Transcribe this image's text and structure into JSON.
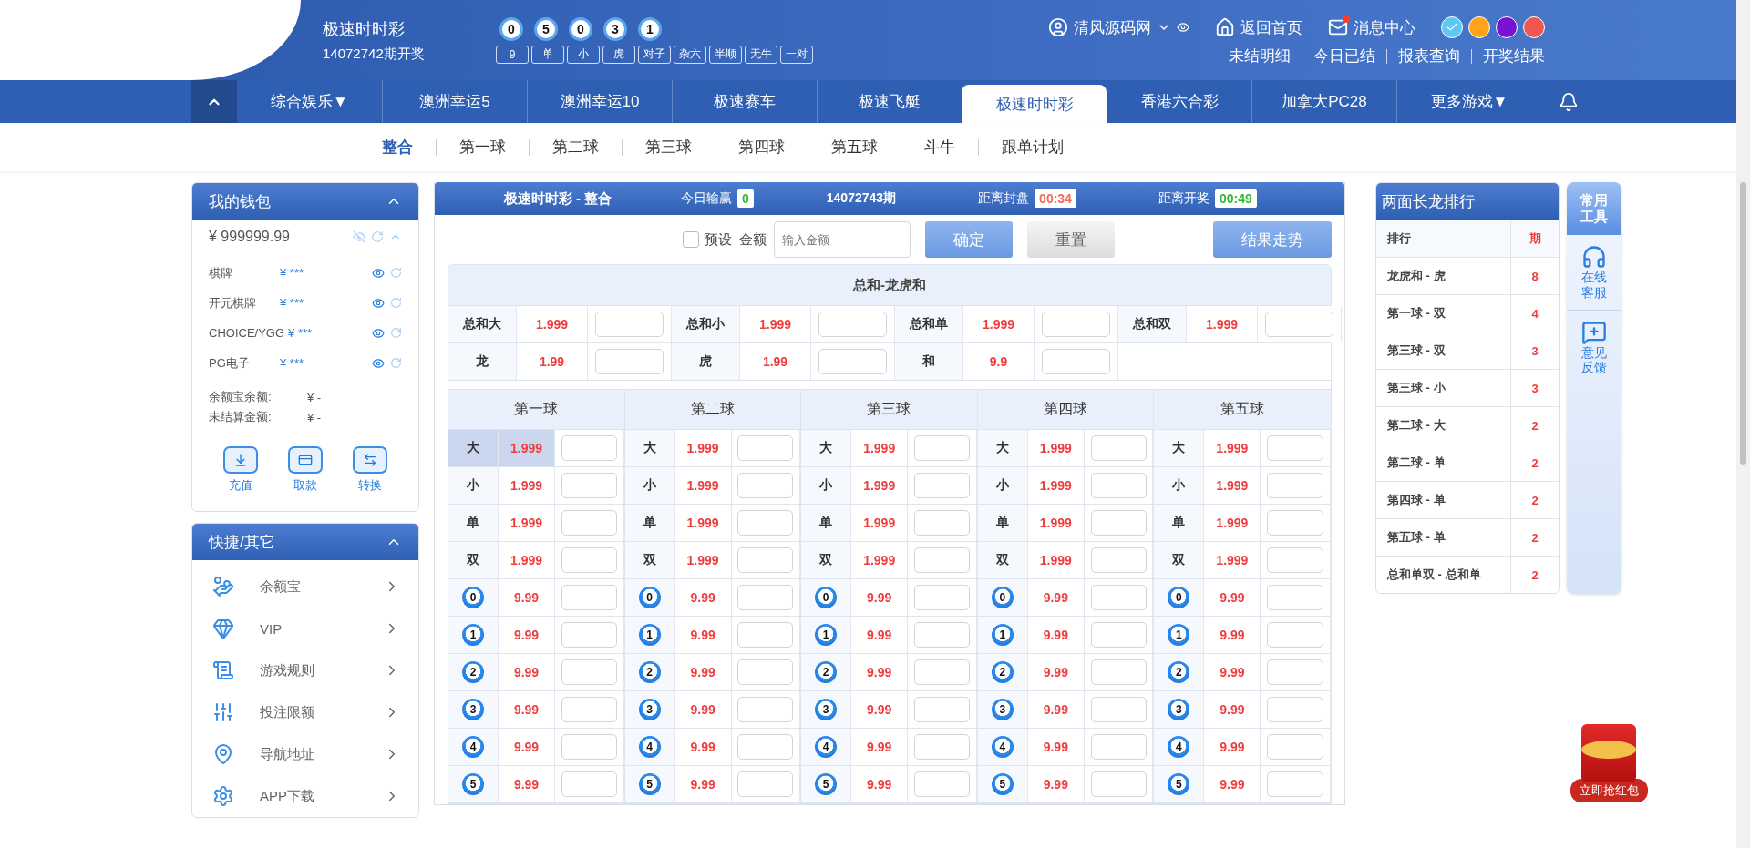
{
  "header": {
    "title": "极速时时彩",
    "issue": "14072742期开奖",
    "balls": [
      "0",
      "5",
      "0",
      "3",
      "1"
    ],
    "tags": [
      "9",
      "单",
      "小",
      "虎",
      "对子",
      "杂六",
      "半顺",
      "无牛",
      "一对"
    ],
    "user": "清风源码网",
    "links": [
      {
        "label": "返回首页",
        "kind": "home",
        "badge": false
      },
      {
        "label": "消息中心",
        "kind": "mail",
        "badge": true
      }
    ],
    "themes": [
      {
        "color": "#5ec8f5",
        "selected": true
      },
      {
        "color": "#ffa31a",
        "selected": false
      },
      {
        "color": "#7a12d6",
        "selected": false
      },
      {
        "color": "#f0584f",
        "selected": false
      }
    ],
    "sub_links": [
      "未结明细",
      "今日已结",
      "报表查询",
      "开奖结果"
    ]
  },
  "nav": [
    {
      "label": "综合娱乐▼",
      "selected": false
    },
    {
      "label": "澳洲幸运5",
      "selected": false
    },
    {
      "label": "澳洲幸运10",
      "selected": false
    },
    {
      "label": "极速赛车",
      "selected": false
    },
    {
      "label": "极速飞艇",
      "selected": false
    },
    {
      "label": "极速时时彩",
      "selected": true
    },
    {
      "label": "香港六合彩",
      "selected": false
    },
    {
      "label": "加拿大PC28",
      "selected": false
    },
    {
      "label": "更多游戏▼",
      "selected": false
    }
  ],
  "subnav": [
    {
      "label": "整合",
      "selected": true
    },
    {
      "label": "第一球",
      "selected": false
    },
    {
      "label": "第二球",
      "selected": false
    },
    {
      "label": "第三球",
      "selected": false
    },
    {
      "label": "第四球",
      "selected": false
    },
    {
      "label": "第五球",
      "selected": false
    },
    {
      "label": "斗牛",
      "selected": false
    },
    {
      "label": "跟单计划",
      "selected": false
    }
  ],
  "wallet": {
    "title": "我的钱包",
    "balance": "¥ 999999.99",
    "accounts": [
      {
        "name": "棋牌",
        "amount": "¥ ***"
      },
      {
        "name": "开元棋牌",
        "amount": "¥ ***"
      },
      {
        "name": "CHOICE/YGG",
        "amount": "¥ ***"
      },
      {
        "name": "PG电子",
        "amount": "¥ ***"
      }
    ],
    "summary": [
      {
        "label": "余额宝余额:",
        "value": "¥ -"
      },
      {
        "label": "未结算金额:",
        "value": "¥ -"
      }
    ],
    "actions": [
      {
        "label": "充值",
        "kind": "deposit"
      },
      {
        "label": "取款",
        "kind": "card"
      },
      {
        "label": "转换",
        "kind": "swap"
      }
    ]
  },
  "quick": {
    "title": "快捷/其它",
    "items": [
      {
        "label": "余额宝",
        "kind": "moneybag"
      },
      {
        "label": "VIP",
        "kind": "vip"
      },
      {
        "label": "游戏规则",
        "kind": "scroll"
      },
      {
        "label": "投注限额",
        "kind": "sliders"
      },
      {
        "label": "导航地址",
        "kind": "pin"
      },
      {
        "label": "APP下载",
        "kind": "gear"
      }
    ]
  },
  "panel": {
    "title": "极速时时彩 - 整合",
    "today_label": "今日输赢",
    "today_value": "0",
    "issue": "14072743期",
    "close_label": "距离封盘",
    "close_time": "00:34",
    "open_label": "距离开奖",
    "open_time": "00:49",
    "preset": {
      "label": "预设",
      "checked": false
    },
    "amount_label": "金额",
    "amount_placeholder": "输入金额",
    "buttons": [
      {
        "label": "确定",
        "kind": "primary"
      },
      {
        "label": "重置",
        "kind": "secondary"
      }
    ],
    "trend_button": "结果走势"
  },
  "sum_section": {
    "title": "总和-龙虎和",
    "rows": [
      [
        {
          "label": "总和大",
          "odds": "1.999"
        },
        {
          "label": "总和小",
          "odds": "1.999"
        },
        {
          "label": "总和单",
          "odds": "1.999"
        },
        {
          "label": "总和双",
          "odds": "1.999"
        }
      ],
      [
        {
          "label": "龙",
          "odds": "1.99"
        },
        {
          "label": "虎",
          "odds": "1.99"
        },
        {
          "label": "和",
          "odds": "9.9"
        }
      ]
    ]
  },
  "balls": [
    {
      "title": "第一球",
      "rows": [
        {
          "kind": "text",
          "label": "大",
          "odds": "1.999",
          "selected": true
        },
        {
          "kind": "text",
          "label": "小",
          "odds": "1.999",
          "selected": false
        },
        {
          "kind": "text",
          "label": "单",
          "odds": "1.999",
          "selected": false
        },
        {
          "kind": "text",
          "label": "双",
          "odds": "1.999",
          "selected": false
        },
        {
          "kind": "ball",
          "label": "0",
          "odds": "9.99",
          "selected": false
        },
        {
          "kind": "ball",
          "label": "1",
          "odds": "9.99",
          "selected": false
        },
        {
          "kind": "ball",
          "label": "2",
          "odds": "9.99",
          "selected": false
        },
        {
          "kind": "ball",
          "label": "3",
          "odds": "9.99",
          "selected": false
        },
        {
          "kind": "ball",
          "label": "4",
          "odds": "9.99",
          "selected": false
        },
        {
          "kind": "ball",
          "label": "5",
          "odds": "9.99",
          "selected": false
        }
      ]
    },
    {
      "title": "第二球",
      "rows": [
        {
          "kind": "text",
          "label": "大",
          "odds": "1.999",
          "selected": false
        },
        {
          "kind": "text",
          "label": "小",
          "odds": "1.999",
          "selected": false
        },
        {
          "kind": "text",
          "label": "单",
          "odds": "1.999",
          "selected": false
        },
        {
          "kind": "text",
          "label": "双",
          "odds": "1.999",
          "selected": false
        },
        {
          "kind": "ball",
          "label": "0",
          "odds": "9.99",
          "selected": false
        },
        {
          "kind": "ball",
          "label": "1",
          "odds": "9.99",
          "selected": false
        },
        {
          "kind": "ball",
          "label": "2",
          "odds": "9.99",
          "selected": false
        },
        {
          "kind": "ball",
          "label": "3",
          "odds": "9.99",
          "selected": false
        },
        {
          "kind": "ball",
          "label": "4",
          "odds": "9.99",
          "selected": false
        },
        {
          "kind": "ball",
          "label": "5",
          "odds": "9.99",
          "selected": false
        }
      ]
    },
    {
      "title": "第三球",
      "rows": [
        {
          "kind": "text",
          "label": "大",
          "odds": "1.999",
          "selected": false
        },
        {
          "kind": "text",
          "label": "小",
          "odds": "1.999",
          "selected": false
        },
        {
          "kind": "text",
          "label": "单",
          "odds": "1.999",
          "selected": false
        },
        {
          "kind": "text",
          "label": "双",
          "odds": "1.999",
          "selected": false
        },
        {
          "kind": "ball",
          "label": "0",
          "odds": "9.99",
          "selected": false
        },
        {
          "kind": "ball",
          "label": "1",
          "odds": "9.99",
          "selected": false
        },
        {
          "kind": "ball",
          "label": "2",
          "odds": "9.99",
          "selected": false
        },
        {
          "kind": "ball",
          "label": "3",
          "odds": "9.99",
          "selected": false
        },
        {
          "kind": "ball",
          "label": "4",
          "odds": "9.99",
          "selected": false
        },
        {
          "kind": "ball",
          "label": "5",
          "odds": "9.99",
          "selected": false
        }
      ]
    },
    {
      "title": "第四球",
      "rows": [
        {
          "kind": "text",
          "label": "大",
          "odds": "1.999",
          "selected": false
        },
        {
          "kind": "text",
          "label": "小",
          "odds": "1.999",
          "selected": false
        },
        {
          "kind": "text",
          "label": "单",
          "odds": "1.999",
          "selected": false
        },
        {
          "kind": "text",
          "label": "双",
          "odds": "1.999",
          "selected": false
        },
        {
          "kind": "ball",
          "label": "0",
          "odds": "9.99",
          "selected": false
        },
        {
          "kind": "ball",
          "label": "1",
          "odds": "9.99",
          "selected": false
        },
        {
          "kind": "ball",
          "label": "2",
          "odds": "9.99",
          "selected": false
        },
        {
          "kind": "ball",
          "label": "3",
          "odds": "9.99",
          "selected": false
        },
        {
          "kind": "ball",
          "label": "4",
          "odds": "9.99",
          "selected": false
        },
        {
          "kind": "ball",
          "label": "5",
          "odds": "9.99",
          "selected": false
        }
      ]
    },
    {
      "title": "第五球",
      "rows": [
        {
          "kind": "text",
          "label": "大",
          "odds": "1.999",
          "selected": false
        },
        {
          "kind": "text",
          "label": "小",
          "odds": "1.999",
          "selected": false
        },
        {
          "kind": "text",
          "label": "单",
          "odds": "1.999",
          "selected": false
        },
        {
          "kind": "text",
          "label": "双",
          "odds": "1.999",
          "selected": false
        },
        {
          "kind": "ball",
          "label": "0",
          "odds": "9.99",
          "selected": false
        },
        {
          "kind": "ball",
          "label": "1",
          "odds": "9.99",
          "selected": false
        },
        {
          "kind": "ball",
          "label": "2",
          "odds": "9.99",
          "selected": false
        },
        {
          "kind": "ball",
          "label": "3",
          "odds": "9.99",
          "selected": false
        },
        {
          "kind": "ball",
          "label": "4",
          "odds": "9.99",
          "selected": false
        },
        {
          "kind": "ball",
          "label": "5",
          "odds": "9.99",
          "selected": false
        }
      ]
    }
  ],
  "ranking": {
    "title": "两面长龙排行",
    "columns": [
      "排行",
      "期"
    ],
    "rows": [
      {
        "name": "龙虎和 - 虎",
        "count": "8"
      },
      {
        "name": "第一球 - 双",
        "count": "4"
      },
      {
        "name": "第三球 - 双",
        "count": "3"
      },
      {
        "name": "第三球 - 小",
        "count": "3"
      },
      {
        "name": "第二球 - 大",
        "count": "2"
      },
      {
        "name": "第二球 - 单",
        "count": "2"
      },
      {
        "name": "第四球 - 单",
        "count": "2"
      },
      {
        "name": "第五球 - 单",
        "count": "2"
      },
      {
        "name": "总和单双 - 总和单",
        "count": "2"
      }
    ]
  },
  "tools": {
    "title": "常用工具",
    "items": [
      {
        "label": "在线客服",
        "kind": "service"
      },
      {
        "label": "意见反馈",
        "kind": "feedback"
      }
    ]
  },
  "red_packet": {
    "label": "立即抢红包"
  }
}
